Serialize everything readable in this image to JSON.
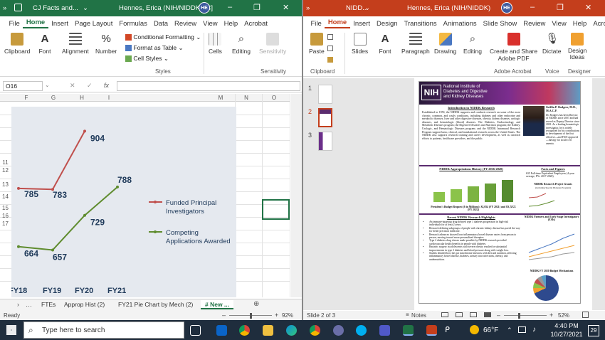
{
  "excel": {
    "title": "CJ Facts and...",
    "user": "Hennes, Erica (NIH/NIDDK) [C]",
    "avatar": "HE",
    "tabs": [
      "File",
      "Home",
      "Insert",
      "Page Layout",
      "Formulas",
      "Data",
      "Review",
      "View",
      "Help",
      "Acrobat"
    ],
    "ribbon": {
      "clipboard": "Clipboard",
      "font": "Font",
      "alignment": "Alignment",
      "number": "Number",
      "conditional": "Conditional Formatting",
      "format_table": "Format as Table",
      "cell_styles": "Cell Styles",
      "styles": "Styles",
      "cells": "Cells",
      "editing": "Editing",
      "sensitivity": "Sensitivity",
      "sensitivity_group": "Sensitivity"
    },
    "name_box": "O16",
    "fx": "fx",
    "columns": [
      "F",
      "G",
      "H",
      "I",
      "M",
      "N",
      "O"
    ],
    "rows": [
      "11",
      "12",
      "13",
      "14",
      "15",
      "16",
      "17"
    ],
    "sheet_tabs": [
      "FTEs",
      "Approp Hist (2)",
      "FY21 Pie Chart by Mech (2)",
      "# New ..."
    ],
    "status": "Ready",
    "zoom": "92%"
  },
  "chart_data": {
    "type": "line",
    "categories": [
      "FY18",
      "FY19",
      "FY20",
      "FY21"
    ],
    "series": [
      {
        "name": "Funded Principal Investigators",
        "values": [
          785,
          783,
          904,
          null
        ],
        "color": "#c0504d"
      },
      {
        "name": "Competing Applications Awarded",
        "values": [
          664,
          657,
          729,
          788
        ],
        "color": "#5f8c2e"
      }
    ],
    "value_labels": [
      "785",
      "783",
      "904",
      "664",
      "657",
      "729",
      "788"
    ],
    "legend": [
      "Funded Principal",
      "Investigators",
      "Competing",
      "Applications Awarded"
    ],
    "ylim": [
      600,
      940
    ]
  },
  "ppt": {
    "title": "NIDD...",
    "user": "Hennes, Erica (NIH/NIDDK)",
    "avatar": "HE",
    "tabs": [
      "File",
      "Home",
      "Insert",
      "Design",
      "Transitions",
      "Animations",
      "Slide Show",
      "Review",
      "View",
      "Help",
      "Acrobat"
    ],
    "ribbon": {
      "paste": "Paste",
      "clipboard": "Clipboard",
      "slides": "Slides",
      "font": "Font",
      "paragraph": "Paragraph",
      "drawing": "Drawing",
      "editing": "Editing",
      "create_share": "Create and Share",
      "adobe_pdf": "Adobe PDF",
      "adobe_acrobat": "Adobe Acrobat",
      "dictate": "Dictate",
      "voice": "Voice",
      "design_ideas": "Design Ideas",
      "designer": "Designer"
    },
    "slide_numbers": [
      "1",
      "2",
      "3"
    ],
    "slide": {
      "org_line1": "National Institute of",
      "org_line2": "Diabetes and Digestive",
      "org_line3": "and Kidney Diseases",
      "nih": "NIH",
      "intro_title": "Introduction to NIDDK Research",
      "intro_body": "Established in 1950, the NIDDK supports and conducts research on some of the most chronic, common, and costly conditions, including diabetes and other endocrine and metabolic diseases, liver and other digestive diseases, obesity, kidney diseases, urologic diseases, and hematologic (blood) diseases. The Diabetes, Endocrinology, and Metabolic Diseases program; the Digestive Diseases and Nutrition program; the Kidney, Urologic, and Hematologic Diseases program; and the NIDDK Intramural Research Program support basic, clinical, and translational research across the United States. The NIDDK also supports research training and career development, as well as outreach efforts to patients, healthcare providers, and the public.",
      "director_name": "Griffin P. Rodgers, M.D., M.A.C.P.",
      "director_body": "Dr. Rodgers has been Director of NIDDK since 2007 and had served as Deputy Director since 2001. As a leading hematologic investigator, he is widely recognized for his contributions to development of the first effective—and FDA-approved—therapy for sickle cell anemia.",
      "approp_title": "NIDDK Appropriations History (FY 2016-2020)",
      "approp_caption": "President's Budget Request ($ in Millions): $2,054 (FY 2021) and $X,XXX (FY 2022)",
      "facts_title": "Facts and Figures",
      "facts_item": "635 Full-time Equivalent Employees (4-year average, FYs 2017-2020)",
      "grants_title": "NIDDK Research Project Grants",
      "grants_sub": "(including Special Diabetes Program)",
      "highlights_title": "Recent NIDDK Research Highlights",
      "highlights": [
        "An immune-targeting drug delayed type 1 diabetes progression in high-risk individuals for at least 2 years.",
        "Research defining subgroups of people with chronic kidney disease has paved the way for better precision medicine.",
        "Research advances showed how inflammatory bowel disease varies from person to person, moving toward more personalized therapies.",
        "Type 2 diabetes drug classes made possible by NIDDK research provided cardiovascular health benefits in people with diabetes.",
        "Bariatric surgery in adolescents with severe obesity resulted in substantial improvements in type 2 diabetes and blood pressure along with weight loss.",
        "Studies detailed how the gut microbiome interacts with diet and nutrition, affecting inflammatory bowel disease, diabetes, urinary tract infections, obesity, and undernutrition."
      ],
      "esi_title": "NIDDK Partners and Early Stage Investigators (ESIs)",
      "budget_title": "NIDDK FY 2020 Budget Mechanisms"
    },
    "status": "Slide 2 of 3",
    "notes": "Notes",
    "zoom": "52%"
  },
  "taskbar": {
    "search_placeholder": "Type here to search",
    "weather": "66°F",
    "time": "4:40 PM",
    "date": "10/27/2021",
    "notifications": "29"
  }
}
